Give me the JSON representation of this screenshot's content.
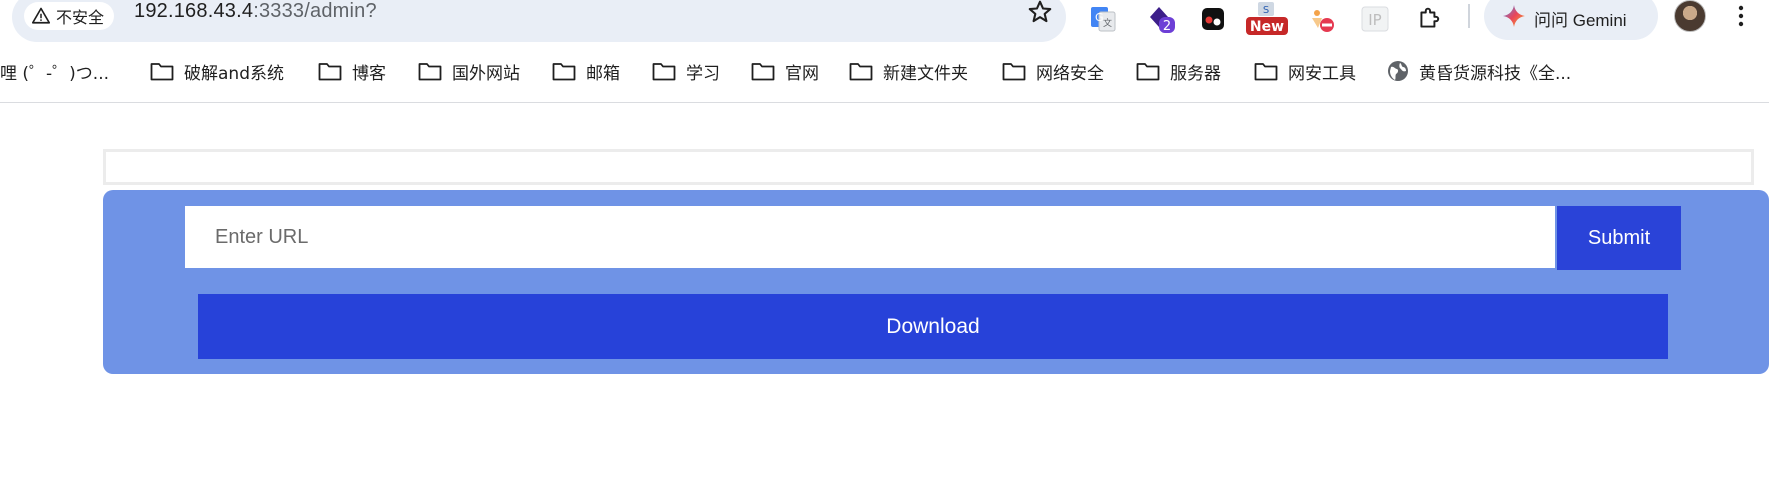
{
  "browser": {
    "security_label": "不安全",
    "url_host": "192.168.43.4",
    "url_rest": ":3333/admin?",
    "gemini_label": "问问 Gemini",
    "extension_badge_new": "New",
    "extension_badge_count": "2",
    "extension_ip": "IP"
  },
  "bookmarks": [
    {
      "label": "哩 (゜-゜)つ...",
      "icon": "tv-icon"
    },
    {
      "label": "破解and系统",
      "icon": "folder-icon"
    },
    {
      "label": "博客",
      "icon": "folder-icon"
    },
    {
      "label": "国外网站",
      "icon": "folder-icon"
    },
    {
      "label": "邮箱",
      "icon": "folder-icon"
    },
    {
      "label": "学习",
      "icon": "folder-icon"
    },
    {
      "label": "官网",
      "icon": "folder-icon"
    },
    {
      "label": "新建文件夹",
      "icon": "folder-icon"
    },
    {
      "label": "网络安全",
      "icon": "folder-icon"
    },
    {
      "label": "服务器",
      "icon": "folder-icon"
    },
    {
      "label": "网安工具",
      "icon": "folder-icon"
    },
    {
      "label": "黄昏货源科技《全...",
      "icon": "globe-icon"
    }
  ],
  "form": {
    "url_placeholder": "Enter URL",
    "url_value": "",
    "submit_label": "Submit",
    "download_label": "Download"
  },
  "colors": {
    "panel": "#6f93e6",
    "button": "#2742d9"
  }
}
